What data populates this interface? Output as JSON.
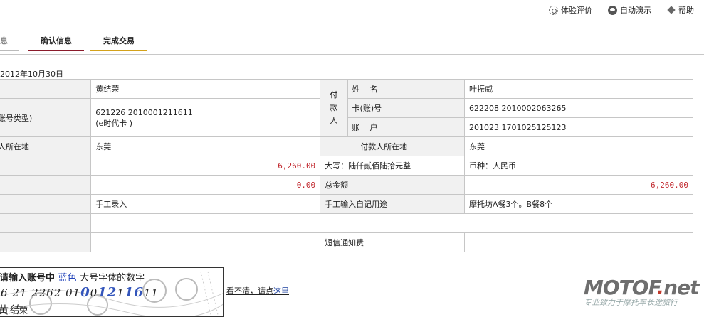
{
  "toplinks": [
    {
      "icon": "sun-icon",
      "label": "体验评价"
    },
    {
      "icon": "play-icon",
      "label": "自动演示"
    },
    {
      "icon": "help-icon",
      "label": "帮助"
    }
  ],
  "tabs": {
    "tab1": "息",
    "tab2": "确认信息",
    "tab3": "完成交易"
  },
  "date": "2012年10月30日",
  "rows": {
    "payee_name_label": "",
    "payee_name": "黄结荣",
    "payer_side": "付\n款\n人",
    "payer_name_label": "姓    名",
    "payer_name": "叶振威",
    "payee_account_label": "账号类型)",
    "payee_account": "621226 2010001211611",
    "payee_card_type": "(e时代卡  )",
    "payer_card_label": "卡(账)号",
    "payer_card": "622208 2010002063265",
    "payer_account_label": "账    户",
    "payer_account": "201023 1701025125123",
    "payee_location_label": "人所在地",
    "payee_location": "东莞",
    "payer_location_label": "付款人所在地",
    "payer_location": "东莞",
    "amount": "6,260.00",
    "amount_words": "大写：陆仟贰佰陆拾元整",
    "currency": "币种：人民币",
    "fee": "0.00",
    "total_label": "总金额",
    "total": "6,260.00",
    "entry_mode": "手工录入",
    "purpose_label": "手工输入自记用途",
    "purpose": "摩托坊A餐3个。B餐8个",
    "sms_label": "短信通知费"
  },
  "captcha": {
    "line1_a": "请输入账号中",
    "line1_b": "蓝色",
    "line1_c": "大号字体的数字",
    "digits_pre": "6 21 2262 01",
    "digits_big1": "0",
    "digits_mid": "0",
    "digits_big2": "12",
    "digits_post": "1",
    "digits_big3": "16",
    "digits_end": "11",
    "name_a": "黄",
    "name_b": "结",
    "name_c": "荣"
  },
  "refresh": {
    "text": "看不清，请点",
    "link": "这里"
  },
  "watermark": {
    "main_a": "MOTOF",
    "main_dot": ".",
    "main_b": "net",
    "sub": "专业致力于摩托车长途旅行"
  }
}
